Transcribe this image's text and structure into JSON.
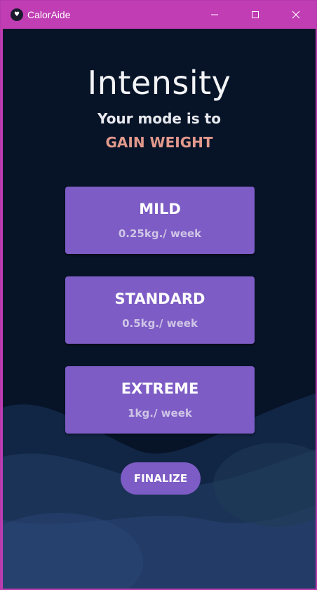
{
  "window": {
    "title": "CalorAide",
    "controls": {
      "minimize": "minimize-icon",
      "maximize": "maximize-icon",
      "close": "close-icon"
    }
  },
  "page": {
    "heading": "Intensity",
    "subheading": "Your mode is to",
    "mode": "GAIN WEIGHT"
  },
  "options": [
    {
      "name": "MILD",
      "rate": "0.25kg./ week"
    },
    {
      "name": "STANDARD",
      "rate": "0.5kg./ week"
    },
    {
      "name": "EXTREME",
      "rate": "1kg./ week"
    }
  ],
  "actions": {
    "finalize": "FINALIZE"
  },
  "colors": {
    "titlebar": "#c03db4",
    "background": "#071428",
    "card": "#7d5cc5",
    "mode_text": "#e2998c"
  }
}
